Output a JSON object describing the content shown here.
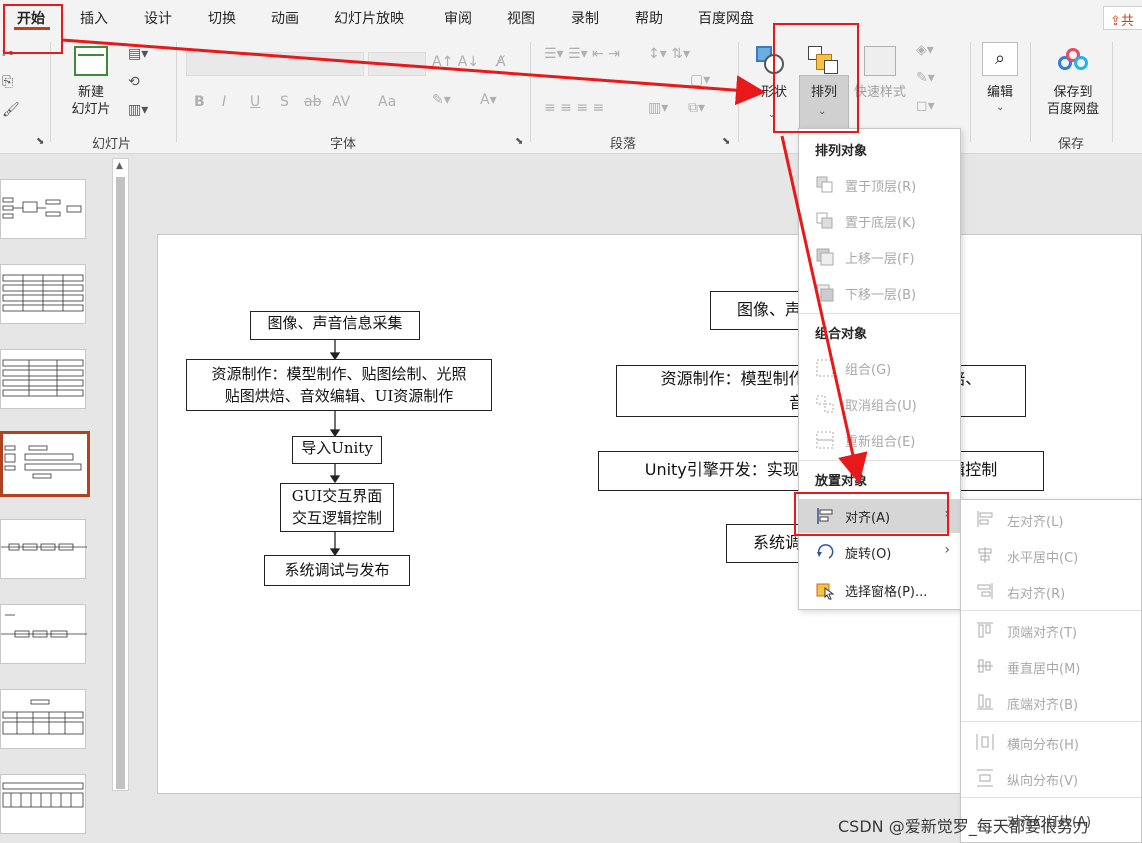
{
  "tabs": [
    "开始",
    "插入",
    "设计",
    "切换",
    "动画",
    "幻灯片放映",
    "审阅",
    "视图",
    "录制",
    "帮助",
    "百度网盘"
  ],
  "share_label": "共",
  "ribbon": {
    "groups": {
      "slides": "幻灯片",
      "font": "字体",
      "paragraph": "段落",
      "save": "保存"
    },
    "new_slide": "新建\n幻灯片",
    "shapes": "形状",
    "arrange": "排列",
    "quick_styles": "快速样式",
    "edit": "编辑",
    "save_baidu": "保存到\n百度网盘",
    "font_buttons": [
      "B",
      "I",
      "U",
      "S",
      "ab",
      "AV",
      "Aa"
    ]
  },
  "slide_content": {
    "left_flow": [
      "图像、声音信息采集",
      "资源制作：模型制作、贴图绘制、光照\n贴图烘焙、音效编辑、UI资源制作",
      "导入Unity",
      "GUI交互界面\n交互逻辑控制",
      "系统调试与发布"
    ],
    "right_flow": [
      "图像、声",
      "资源制作：模型制作、                   图烘焙、\n音效编辑",
      "Unity引擎开发：实现G                        逻辑控制",
      "系统调"
    ]
  },
  "menu": {
    "header_arrange": "排列对象",
    "items_arrange": [
      "置于顶层(R)",
      "置于底层(K)",
      "上移一层(F)",
      "下移一层(B)"
    ],
    "header_group": "组合对象",
    "items_group": [
      "组合(G)",
      "取消组合(U)",
      "重新组合(E)"
    ],
    "header_position": "放置对象",
    "align": "对齐(A)",
    "rotate": "旋转(O)",
    "selection_pane": "选择窗格(P)..."
  },
  "submenu": {
    "items": [
      "左对齐(L)",
      "水平居中(C)",
      "右对齐(R)",
      "顶端对齐(T)",
      "垂直居中(M)",
      "底端对齐(B)",
      "横向分布(H)",
      "纵向分布(V)",
      "对齐幻灯片(A)"
    ]
  },
  "watermark": "CSDN @爱新觉罗_每天都要很努力",
  "colors": {
    "accent": "#c43e1c",
    "annotation": "#e8191b"
  }
}
